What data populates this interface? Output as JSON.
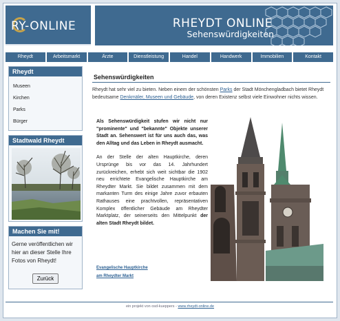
{
  "header": {
    "logo_text": "RY-ONLINE",
    "site_title": "RHEYDT ONLINE",
    "site_subtitle": "Sehenswürdigkeiten"
  },
  "nav": {
    "items": [
      {
        "label": "Rheydt"
      },
      {
        "label": "Arbeitsmarkt"
      },
      {
        "label": "Ärzte"
      },
      {
        "label": "Dienstleistung"
      },
      {
        "label": "Handel"
      },
      {
        "label": "Handwerk"
      },
      {
        "label": "Immobilien"
      },
      {
        "label": "Kontakt"
      }
    ]
  },
  "sidebar": {
    "rheydt_box": {
      "title": "Rheydt",
      "items": [
        {
          "label": "Museen"
        },
        {
          "label": "Kirchen"
        },
        {
          "label": "Parks"
        },
        {
          "label": "Bürger"
        }
      ]
    },
    "stadtwald_box": {
      "title": "Stadtwald Rheydt"
    },
    "promo_box": {
      "title": "Machen Sie mit!",
      "text": "Gerne veröffentlichen wir hier an dieser Stelle Ihre Fotos von Rheydt!",
      "button_label": "Zurück"
    }
  },
  "main": {
    "title": "Sehenswürdigkeiten",
    "intro_part1": "Rheydt hat sehr viel zu bieten. Neben einem der schönsten ",
    "intro_link1": "Parks",
    "intro_part2": " der Stadt Mönchengladbach bietet Rheydt bedeutsame ",
    "intro_link2": "Denkmäler, Museen und Gebäude",
    "intro_part3": ", von deren Existenz selbst viele Einwohner nichts wissen.",
    "para_bold": "Als Sehenswürdigkeit stufen wir nicht nur \"prominente\" und \"bekannte\" Objekte unserer Stadt an. Sehenswert ist für uns auch das, was den Alltag und das Leben in Rheydt ausmacht.",
    "para_normal_part1": "An der Stelle der alten Hauptkirche, deren Ursprünge bis vor das 14. Jahrhundert zurückreichen, erhebt sich weit sichtbar die 1902 neu errichtete Evangelische Hauptkirche am Rheydter Markt. Sie bildet zusammen mit dem markanten Turm des einige Jahre zuvor erbauten Rathauses eine prachtvollen, repräsentativen Komplex öffentlicher Gebäude am Rheydter Marktplatz, der seinerseits den Mittelpunkt ",
    "para_normal_bold": "der alten Stadt Rheydt bildet.",
    "link_line1": "Evangelische Hauptkirche",
    "link_line2": "am Rheydter Markt"
  },
  "footer": {
    "text": "ein projekt von osd-kueppers - ",
    "link": "www.rheydt-online.de"
  },
  "colors": {
    "brand": "#3f6a90",
    "link": "#2b5f92",
    "page_bg": "#dfe6ee"
  }
}
